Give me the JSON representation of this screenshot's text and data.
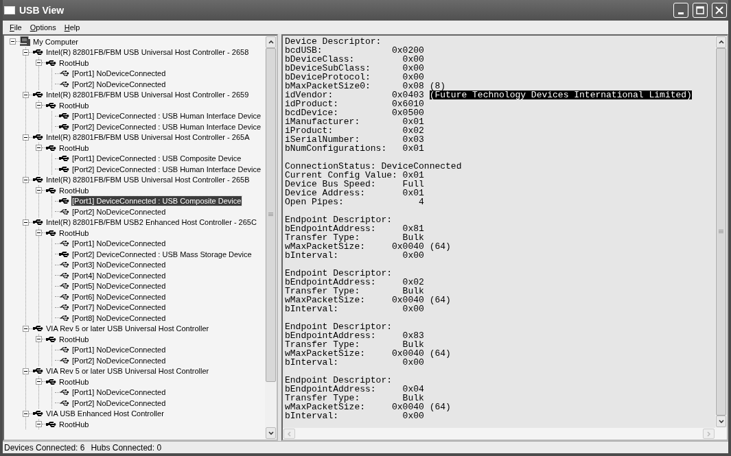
{
  "window": {
    "title": "USB View"
  },
  "menu": [
    "File",
    "Options",
    "Help"
  ],
  "tree": [
    {
      "kind": "computer",
      "label": "My Computer",
      "expanded": true,
      "selected": false,
      "children": [
        {
          "kind": "controller",
          "label": "Intel(R) 82801FB/FBM USB Universal Host Controller - 2658",
          "expanded": true,
          "selected": false,
          "children": [
            {
              "kind": "hub",
              "label": "RootHub",
              "expanded": true,
              "selected": false,
              "children": [
                {
                  "kind": "port",
                  "label": "[Port1] NoDeviceConnected",
                  "connected": false,
                  "selected": false
                },
                {
                  "kind": "port",
                  "label": "[Port2] NoDeviceConnected",
                  "connected": false,
                  "selected": false
                }
              ]
            }
          ]
        },
        {
          "kind": "controller",
          "label": "Intel(R) 82801FB/FBM USB Universal Host Controller - 2659",
          "expanded": true,
          "selected": false,
          "children": [
            {
              "kind": "hub",
              "label": "RootHub",
              "expanded": true,
              "selected": false,
              "children": [
                {
                  "kind": "port",
                  "label": "[Port1] DeviceConnected :  USB Human Interface Device",
                  "connected": true,
                  "selected": false
                },
                {
                  "kind": "port",
                  "label": "[Port2] DeviceConnected :  USB Human Interface Device",
                  "connected": true,
                  "selected": false
                }
              ]
            }
          ]
        },
        {
          "kind": "controller",
          "label": "Intel(R) 82801FB/FBM USB Universal Host Controller - 265A",
          "expanded": true,
          "selected": false,
          "children": [
            {
              "kind": "hub",
              "label": "RootHub",
              "expanded": true,
              "selected": false,
              "children": [
                {
                  "kind": "port",
                  "label": "[Port1] DeviceConnected :  USB Composite Device",
                  "connected": true,
                  "selected": false
                },
                {
                  "kind": "port",
                  "label": "[Port2] DeviceConnected :  USB Human Interface Device",
                  "connected": true,
                  "selected": false
                }
              ]
            }
          ]
        },
        {
          "kind": "controller",
          "label": "Intel(R) 82801FB/FBM USB Universal Host Controller - 265B",
          "expanded": true,
          "selected": false,
          "children": [
            {
              "kind": "hub",
              "label": "RootHub",
              "expanded": true,
              "selected": false,
              "children": [
                {
                  "kind": "port",
                  "label": "[Port1] DeviceConnected :  USB Composite Device",
                  "connected": true,
                  "selected": true
                },
                {
                  "kind": "port",
                  "label": "[Port2] NoDeviceConnected",
                  "connected": false,
                  "selected": false
                }
              ]
            }
          ]
        },
        {
          "kind": "controller",
          "label": "Intel(R) 82801FB/FBM USB2 Enhanced Host Controller - 265C",
          "expanded": true,
          "selected": false,
          "children": [
            {
              "kind": "hub",
              "label": "RootHub",
              "expanded": true,
              "selected": false,
              "children": [
                {
                  "kind": "port",
                  "label": "[Port1] NoDeviceConnected",
                  "connected": false,
                  "selected": false
                },
                {
                  "kind": "port",
                  "label": "[Port2] DeviceConnected :  USB Mass Storage Device",
                  "connected": true,
                  "selected": false
                },
                {
                  "kind": "port",
                  "label": "[Port3] NoDeviceConnected",
                  "connected": false,
                  "selected": false
                },
                {
                  "kind": "port",
                  "label": "[Port4] NoDeviceConnected",
                  "connected": false,
                  "selected": false
                },
                {
                  "kind": "port",
                  "label": "[Port5] NoDeviceConnected",
                  "connected": false,
                  "selected": false
                },
                {
                  "kind": "port",
                  "label": "[Port6] NoDeviceConnected",
                  "connected": false,
                  "selected": false
                },
                {
                  "kind": "port",
                  "label": "[Port7] NoDeviceConnected",
                  "connected": false,
                  "selected": false
                },
                {
                  "kind": "port",
                  "label": "[Port8] NoDeviceConnected",
                  "connected": false,
                  "selected": false
                }
              ]
            }
          ]
        },
        {
          "kind": "controller",
          "label": "VIA Rev 5 or later USB Universal Host Controller",
          "expanded": true,
          "selected": false,
          "children": [
            {
              "kind": "hub",
              "label": "RootHub",
              "expanded": true,
              "selected": false,
              "children": [
                {
                  "kind": "port",
                  "label": "[Port1] NoDeviceConnected",
                  "connected": false,
                  "selected": false
                },
                {
                  "kind": "port",
                  "label": "[Port2] NoDeviceConnected",
                  "connected": false,
                  "selected": false
                }
              ]
            }
          ]
        },
        {
          "kind": "controller",
          "label": "VIA Rev 5 or later USB Universal Host Controller",
          "expanded": true,
          "selected": false,
          "children": [
            {
              "kind": "hub",
              "label": "RootHub",
              "expanded": true,
              "selected": false,
              "children": [
                {
                  "kind": "port",
                  "label": "[Port1] NoDeviceConnected",
                  "connected": false,
                  "selected": false
                },
                {
                  "kind": "port",
                  "label": "[Port2] NoDeviceConnected",
                  "connected": false,
                  "selected": false
                }
              ]
            }
          ]
        },
        {
          "kind": "controller",
          "label": "VIA USB Enhanced Host Controller",
          "expanded": true,
          "selected": false,
          "children": [
            {
              "kind": "hub",
              "label": "RootHub",
              "expanded": true,
              "selected": false
            }
          ]
        }
      ]
    }
  ],
  "details": [
    {
      "lines": [
        {
          "kind": "heading",
          "text": "Device Descriptor:"
        },
        {
          "kind": "field",
          "label": "bcdUSB:",
          "value": "0x0200"
        },
        {
          "kind": "field",
          "label": "bDeviceClass:",
          "value": "0x00"
        },
        {
          "kind": "field",
          "label": "bDeviceSubClass:",
          "value": "0x00"
        },
        {
          "kind": "field",
          "label": "bDeviceProtocol:",
          "value": "0x00"
        },
        {
          "kind": "field",
          "label": "bMaxPacketSize0:",
          "value": "0x08",
          "extra": "(8)",
          "selected": false
        },
        {
          "kind": "field",
          "label": "idVendor:",
          "value": "0x0403",
          "extra": "(Future Technology Devices International Limited)",
          "selected": true
        },
        {
          "kind": "field",
          "label": "idProduct:",
          "value": "0x6010"
        },
        {
          "kind": "field",
          "label": "bcdDevice:",
          "value": "0x0500"
        },
        {
          "kind": "field",
          "label": "iManufacturer:",
          "value": "0x01"
        },
        {
          "kind": "field",
          "label": "iProduct:",
          "value": "0x02"
        },
        {
          "kind": "field",
          "label": "iSerialNumber:",
          "value": "0x03"
        },
        {
          "kind": "field",
          "label": "bNumConfigurations:",
          "value": "0x01"
        }
      ]
    },
    {
      "lines": [
        {
          "kind": "inline",
          "label": "ConnectionStatus:",
          "value": "DeviceConnected"
        },
        {
          "kind": "field",
          "label": "Current Config Value:",
          "value": "0x01"
        },
        {
          "kind": "field",
          "label": "Device Bus Speed:",
          "value": "Full"
        },
        {
          "kind": "field",
          "label": "Device Address:",
          "value": "0x01"
        },
        {
          "kind": "field",
          "label": "Open Pipes:",
          "value": "4"
        }
      ]
    },
    {
      "lines": [
        {
          "kind": "heading",
          "text": "Endpoint Descriptor:"
        },
        {
          "kind": "field",
          "label": "bEndpointAddress:",
          "value": "0x81"
        },
        {
          "kind": "field",
          "label": "Transfer Type:",
          "value": "Bulk"
        },
        {
          "kind": "field",
          "label": "wMaxPacketSize:",
          "value": "0x0040",
          "extra": "(64)",
          "selected": false
        },
        {
          "kind": "field",
          "label": "bInterval:",
          "value": "0x00"
        }
      ]
    },
    {
      "lines": [
        {
          "kind": "heading",
          "text": "Endpoint Descriptor:"
        },
        {
          "kind": "field",
          "label": "bEndpointAddress:",
          "value": "0x02"
        },
        {
          "kind": "field",
          "label": "Transfer Type:",
          "value": "Bulk"
        },
        {
          "kind": "field",
          "label": "wMaxPacketSize:",
          "value": "0x0040",
          "extra": "(64)",
          "selected": false
        },
        {
          "kind": "field",
          "label": "bInterval:",
          "value": "0x00"
        }
      ]
    },
    {
      "lines": [
        {
          "kind": "heading",
          "text": "Endpoint Descriptor:"
        },
        {
          "kind": "field",
          "label": "bEndpointAddress:",
          "value": "0x83"
        },
        {
          "kind": "field",
          "label": "Transfer Type:",
          "value": "Bulk"
        },
        {
          "kind": "field",
          "label": "wMaxPacketSize:",
          "value": "0x0040",
          "extra": "(64)",
          "selected": false
        },
        {
          "kind": "field",
          "label": "bInterval:",
          "value": "0x00"
        }
      ]
    },
    {
      "lines": [
        {
          "kind": "heading",
          "text": "Endpoint Descriptor:"
        },
        {
          "kind": "field",
          "label": "bEndpointAddress:",
          "value": "0x04"
        },
        {
          "kind": "field",
          "label": "Transfer Type:",
          "value": "Bulk"
        },
        {
          "kind": "field",
          "label": "wMaxPacketSize:",
          "value": "0x0040",
          "extra": "(64)",
          "selected": false
        },
        {
          "kind": "field",
          "label": "bInterval:",
          "value": "0x00"
        }
      ]
    }
  ],
  "status_bar": [
    "Devices Connected: 6",
    "Hubs Connected: 0"
  ]
}
